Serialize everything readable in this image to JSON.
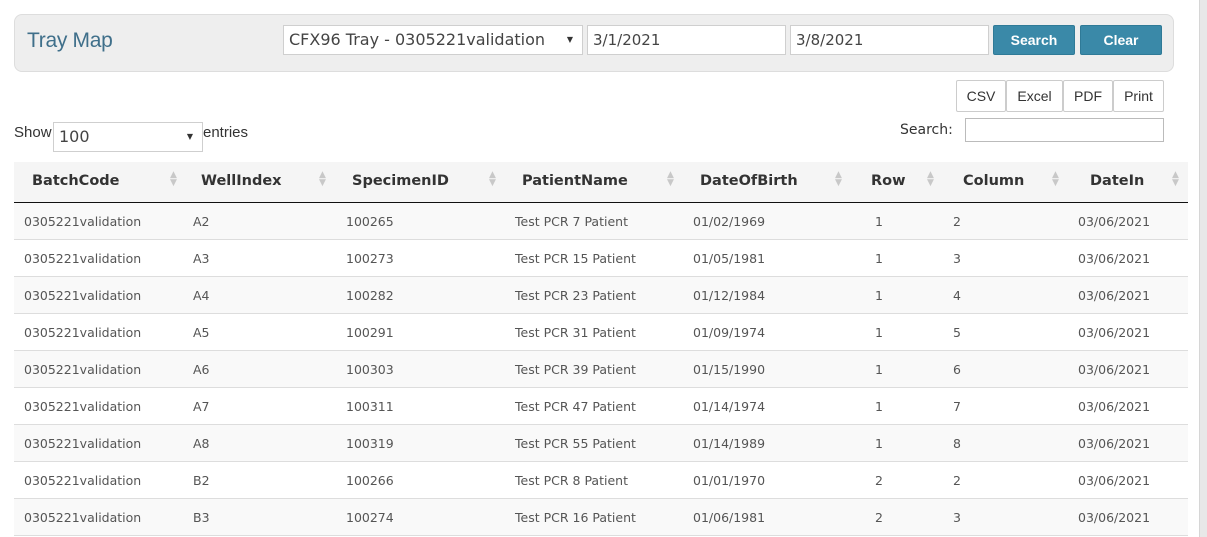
{
  "header": {
    "title": "Tray Map",
    "tray_select": "CFX96 Tray - 0305221validation",
    "date_from": "3/1/2021",
    "date_to": "3/8/2021",
    "search_label": "Search",
    "clear_label": "Clear"
  },
  "export": {
    "csv": "CSV",
    "excel": "Excel",
    "pdf": "PDF",
    "print": "Print"
  },
  "length": {
    "show": "Show",
    "value": "100",
    "entries": "entries"
  },
  "filter": {
    "label": "Search:",
    "value": ""
  },
  "table": {
    "columns": [
      "BatchCode",
      "WellIndex",
      "SpecimenID",
      "PatientName",
      "DateOfBirth",
      "Row",
      "Column",
      "DateIn"
    ],
    "rows": [
      [
        "0305221validation",
        "A2",
        "100265",
        "Test PCR 7 Patient",
        "01/02/1969",
        "1",
        "2",
        "03/06/2021"
      ],
      [
        "0305221validation",
        "A3",
        "100273",
        "Test PCR 15 Patient",
        "01/05/1981",
        "1",
        "3",
        "03/06/2021"
      ],
      [
        "0305221validation",
        "A4",
        "100282",
        "Test PCR 23 Patient",
        "01/12/1984",
        "1",
        "4",
        "03/06/2021"
      ],
      [
        "0305221validation",
        "A5",
        "100291",
        "Test PCR 31 Patient",
        "01/09/1974",
        "1",
        "5",
        "03/06/2021"
      ],
      [
        "0305221validation",
        "A6",
        "100303",
        "Test PCR 39 Patient",
        "01/15/1990",
        "1",
        "6",
        "03/06/2021"
      ],
      [
        "0305221validation",
        "A7",
        "100311",
        "Test PCR 47 Patient",
        "01/14/1974",
        "1",
        "7",
        "03/06/2021"
      ],
      [
        "0305221validation",
        "A8",
        "100319",
        "Test PCR 55 Patient",
        "01/14/1989",
        "1",
        "8",
        "03/06/2021"
      ],
      [
        "0305221validation",
        "B2",
        "100266",
        "Test PCR 8 Patient",
        "01/01/1970",
        "2",
        "2",
        "03/06/2021"
      ],
      [
        "0305221validation",
        "B3",
        "100274",
        "Test PCR 16 Patient",
        "01/06/1981",
        "2",
        "3",
        "03/06/2021"
      ]
    ]
  }
}
